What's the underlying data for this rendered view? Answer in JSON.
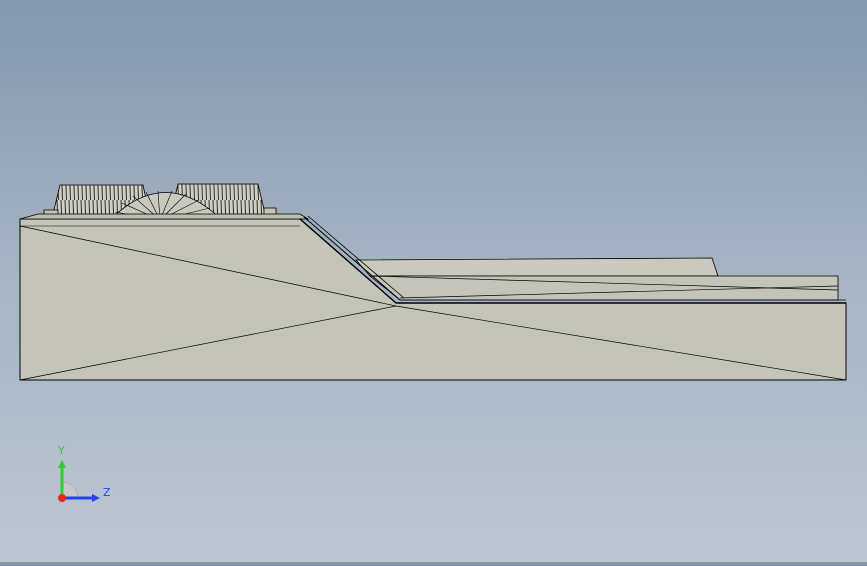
{
  "viewport": {
    "background_top": "#8497ac",
    "background_bottom": "#bdc7d1"
  },
  "model": {
    "face_color": "#c4c4b8",
    "edge_color": "#000000"
  },
  "triad": {
    "x_label": "",
    "y_label": "Y",
    "z_label": "Z",
    "y_color": "#33cc33",
    "z_color": "#2244ee",
    "x_color": "#ee2222"
  }
}
